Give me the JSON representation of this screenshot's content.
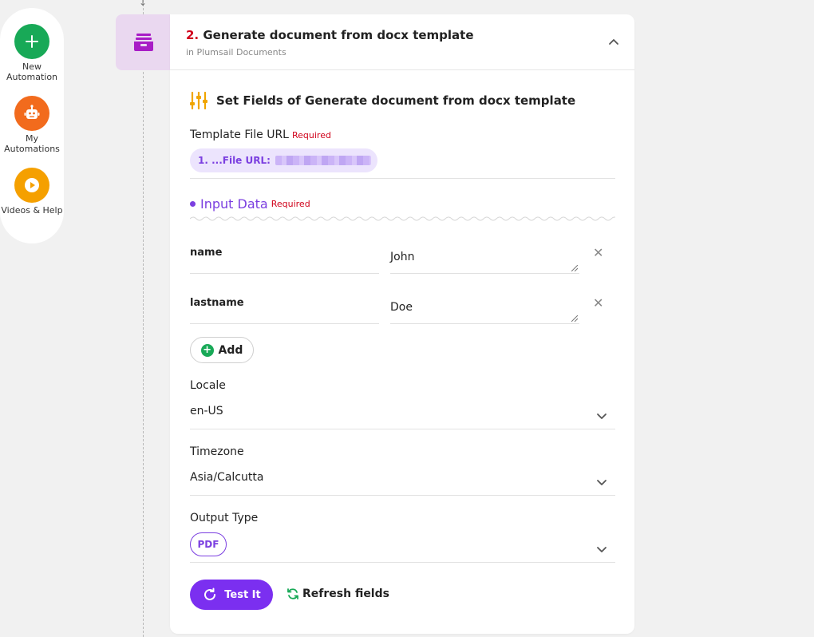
{
  "nav": {
    "new_automation": "New Automation",
    "my_automations": "My Automations",
    "videos_help": "Videos & Help",
    "colors": {
      "new": "#18a957",
      "my": "#f26b1d",
      "videos": "#f5a000"
    }
  },
  "step": {
    "number": "2.",
    "title": "Generate document from docx template",
    "subtitle": "in Plumsail Documents"
  },
  "section_title": "Set Fields of Generate document from docx template",
  "template_file": {
    "label": "Template File URL",
    "required": "Required",
    "value": "1. ...File URL:"
  },
  "input_data": {
    "label": "Input Data",
    "required": "Required",
    "rows": [
      {
        "key": "name",
        "value": "John"
      },
      {
        "key": "lastname",
        "value": "Doe"
      }
    ],
    "add_label": "Add"
  },
  "locale": {
    "label": "Locale",
    "value": "en-US"
  },
  "timezone": {
    "label": "Timezone",
    "value": "Asia/Calcutta"
  },
  "output_type": {
    "label": "Output Type",
    "value": "PDF"
  },
  "actions": {
    "test_label": "Test It",
    "refresh_label": "Refresh fields"
  },
  "accent_color": "#7b2ff0"
}
